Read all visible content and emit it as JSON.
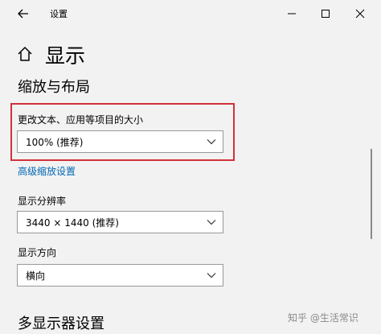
{
  "window": {
    "title": "设置",
    "back_icon": "back-arrow-icon",
    "min_icon": "minimize-icon",
    "max_icon": "maximize-icon",
    "close_icon": "close-icon"
  },
  "header": {
    "home_icon": "home-icon",
    "title": "显示"
  },
  "scale_section": {
    "title": "缩放与布局",
    "scale_label": "更改文本、应用等项目的大小",
    "scale_value": "100% (推荐)",
    "advanced_link": "高级缩放设置",
    "resolution_label": "显示分辨率",
    "resolution_value": "3440 × 1440 (推荐)",
    "orientation_label": "显示方向",
    "orientation_value": "横向"
  },
  "multi_display": {
    "title": "多显示器设置"
  },
  "watermark": "知乎 @生活常识",
  "colors": {
    "highlight_border": "#d2323a",
    "link": "#0066b4",
    "window_bg": "#f2f2f2"
  }
}
